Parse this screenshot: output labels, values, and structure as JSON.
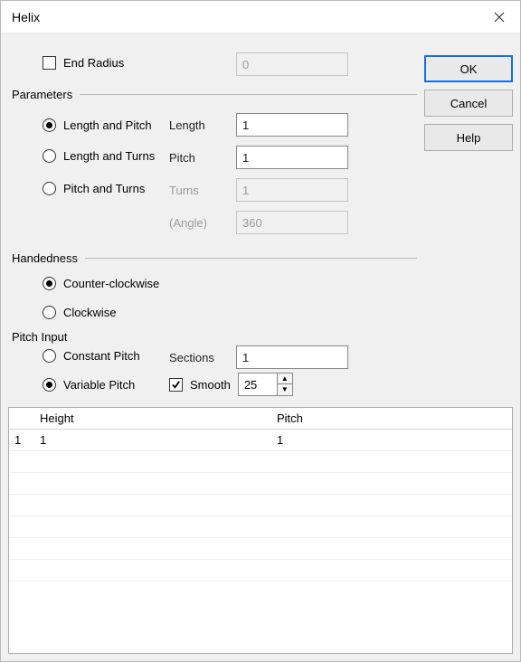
{
  "title": "Helix",
  "buttons": {
    "ok": "OK",
    "cancel": "Cancel",
    "help": "Help"
  },
  "endRadius": {
    "label": "End Radius",
    "value": "0",
    "checked": false
  },
  "parameters": {
    "header": "Parameters",
    "options": {
      "lengthPitch": "Length and Pitch",
      "lengthTurns": "Length and Turns",
      "pitchTurns": "Pitch and Turns"
    },
    "selected": "lengthPitch",
    "fields": {
      "length": {
        "label": "Length",
        "value": "1",
        "enabled": true
      },
      "pitch": {
        "label": "Pitch",
        "value": "1",
        "enabled": true
      },
      "turns": {
        "label": "Turns",
        "value": "1",
        "enabled": false
      },
      "angle": {
        "label": "(Angle)",
        "value": "360",
        "enabled": false
      }
    }
  },
  "handedness": {
    "header": "Handedness",
    "options": {
      "ccw": "Counter-clockwise",
      "cw": "Clockwise"
    },
    "selected": "ccw"
  },
  "pitchInput": {
    "header": "Pitch Input",
    "options": {
      "constant": "Constant Pitch",
      "variable": "Variable Pitch"
    },
    "selected": "variable",
    "sectionsLabel": "Sections",
    "sectionsValue": "1",
    "smoothLabel": "Smooth",
    "smoothChecked": true,
    "smoothValue": "25"
  },
  "table": {
    "headers": {
      "height": "Height",
      "pitch": "Pitch"
    },
    "rows": [
      {
        "n": "1",
        "height": "1",
        "pitch": "1"
      }
    ],
    "emptyRows": 6
  }
}
